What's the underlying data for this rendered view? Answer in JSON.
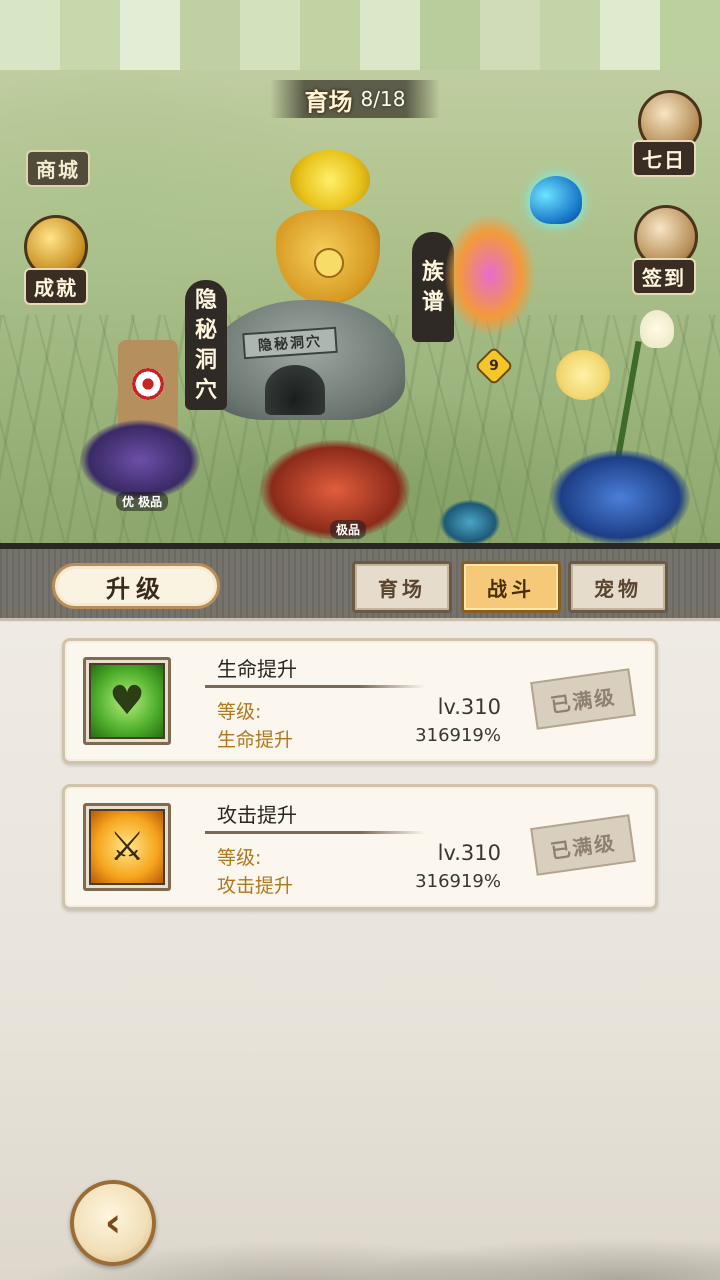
{
  "scene": {
    "title": "育场",
    "progress": "8/18",
    "seven_day_label": "七日",
    "sign_in_label": "签到",
    "achievement_label": "成就",
    "mail_label": "商城",
    "hidden_cave_label": "隐秘洞穴",
    "cave_plaque": "隐秘洞穴",
    "clan_label": "族谱",
    "clan_level": "9",
    "scarecrow_tier": "优 极品",
    "center_tier": "极品"
  },
  "panel": {
    "header_label": "升级",
    "tabs": [
      {
        "label": "育场",
        "active": false
      },
      {
        "label": "战斗",
        "active": true
      },
      {
        "label": "宠物",
        "active": false
      }
    ]
  },
  "upgrades": [
    {
      "icon": "mantis-heart-icon",
      "name": "生命提升",
      "level_label": "等级:",
      "level_value": "lv.310",
      "stat_label": "生命提升",
      "stat_value": "316919%",
      "status": "已满级"
    },
    {
      "icon": "mantis-claw-icon",
      "name": "攻击提升",
      "level_label": "等级:",
      "level_value": "lv.310",
      "stat_label": "攻击提升",
      "stat_value": "316919%",
      "status": "已满级"
    }
  ],
  "colors": {
    "accent_tab": "#f5c977",
    "label_orange": "#b0781e",
    "panel_bg": "#efebe4"
  }
}
